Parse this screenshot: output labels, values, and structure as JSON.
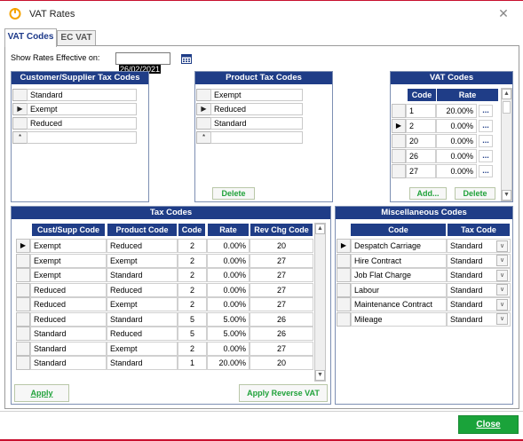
{
  "window": {
    "title": "VAT Rates",
    "close_glyph": "✕"
  },
  "tabs": [
    {
      "label": "VAT Codes"
    },
    {
      "label": "EC VAT"
    }
  ],
  "effective": {
    "label": "Show Rates Effective on:",
    "date": "26/02/2021"
  },
  "customer_codes": {
    "title": "Customer/Supplier Tax Codes",
    "rows": [
      "Standard",
      "Exempt",
      "Reduced",
      ""
    ]
  },
  "product_codes": {
    "title": "Product Tax Codes",
    "rows": [
      "Exempt",
      "Reduced",
      "Standard",
      ""
    ],
    "delete_label": "Delete"
  },
  "vat_codes": {
    "title": "VAT Codes",
    "headers": [
      "Code",
      "Rate"
    ],
    "rows": [
      {
        "code": "1",
        "rate": "20.00%"
      },
      {
        "code": "2",
        "rate": "0.00%"
      },
      {
        "code": "20",
        "rate": "0.00%"
      },
      {
        "code": "26",
        "rate": "0.00%"
      },
      {
        "code": "27",
        "rate": "0.00%"
      }
    ],
    "ellipsis": "...",
    "add_label": "Add...",
    "delete_label": "Delete"
  },
  "tax_codes": {
    "title": "Tax Codes",
    "headers": [
      "Cust/Supp Code",
      "Product Code",
      "Code",
      "Rate",
      "Rev Chg Code"
    ],
    "rows": [
      {
        "cust": "Exempt",
        "prod": "Reduced",
        "code": "2",
        "rate": "0.00%",
        "rev": "20"
      },
      {
        "cust": "Exempt",
        "prod": "Exempt",
        "code": "2",
        "rate": "0.00%",
        "rev": "27"
      },
      {
        "cust": "Exempt",
        "prod": "Standard",
        "code": "2",
        "rate": "0.00%",
        "rev": "27"
      },
      {
        "cust": "Reduced",
        "prod": "Reduced",
        "code": "2",
        "rate": "0.00%",
        "rev": "27"
      },
      {
        "cust": "Reduced",
        "prod": "Exempt",
        "code": "2",
        "rate": "0.00%",
        "rev": "27"
      },
      {
        "cust": "Reduced",
        "prod": "Standard",
        "code": "5",
        "rate": "5.00%",
        "rev": "26"
      },
      {
        "cust": "Standard",
        "prod": "Reduced",
        "code": "5",
        "rate": "5.00%",
        "rev": "26"
      },
      {
        "cust": "Standard",
        "prod": "Exempt",
        "code": "2",
        "rate": "0.00%",
        "rev": "27"
      },
      {
        "cust": "Standard",
        "prod": "Standard",
        "code": "1",
        "rate": "20.00%",
        "rev": "20"
      }
    ],
    "apply_label": "Apply",
    "apply_reverse_label": "Apply Reverse VAT"
  },
  "misc_codes": {
    "title": "Miscellaneous Codes",
    "headers": [
      "Code",
      "Tax Code"
    ],
    "rows": [
      {
        "code": "Despatch Carriage",
        "tax": "Standard"
      },
      {
        "code": "Hire Contract",
        "tax": "Standard"
      },
      {
        "code": "Job Flat Charge",
        "tax": "Standard"
      },
      {
        "code": "Labour",
        "tax": "Standard"
      },
      {
        "code": "Maintenance Contract",
        "tax": "Standard"
      },
      {
        "code": "Mileage",
        "tax": "Standard"
      }
    ]
  },
  "footer": {
    "close_label": "Close"
  },
  "glyphs": {
    "row_pointer": "▶",
    "new_row": "*",
    "dropdown": "∨",
    "scroll_up": "▲",
    "scroll_down": "▼"
  }
}
